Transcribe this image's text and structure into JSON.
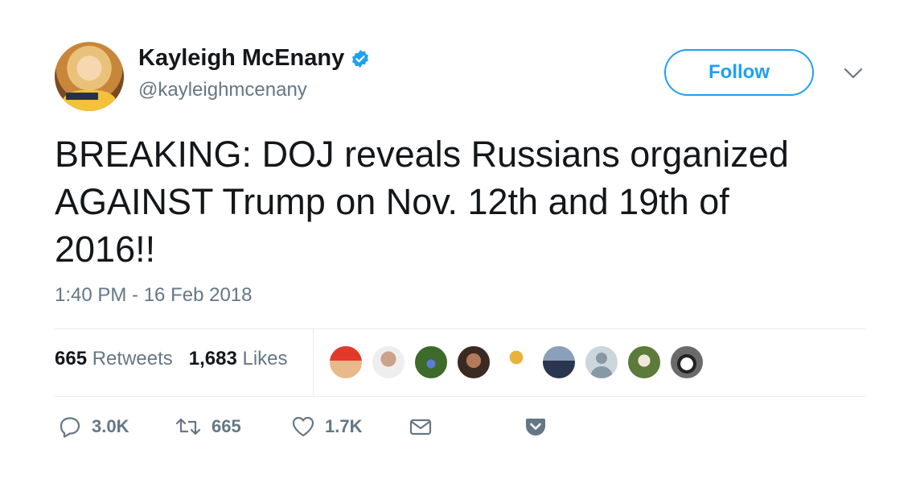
{
  "tweet": {
    "display_name": "Kayleigh McEnany",
    "handle": "@kayleighmcenany",
    "follow_label": "Follow",
    "text_lines": [
      "BREAKING: DOJ reveals Russians organized",
      "AGAINST Trump on Nov. 12th and 19th of",
      "2016!!"
    ],
    "timestamp": "1:40 PM - 16 Feb 2018"
  },
  "stats": {
    "retweets_count": "665",
    "retweets_label": "Retweets",
    "likes_count": "1,683",
    "likes_label": "Likes"
  },
  "actions": {
    "reply_count": "3.0K",
    "retweet_count": "665",
    "like_count": "1.7K"
  },
  "icons": {
    "verified": "verified-badge-icon",
    "caret": "chevron-down-icon",
    "reply": "reply-icon",
    "retweet": "retweet-icon",
    "like": "heart-icon",
    "message": "envelope-icon",
    "save": "pocket-icon"
  },
  "colors": {
    "accent": "#1da1f2",
    "text": "#14171a",
    "secondary": "#657786",
    "divider": "#e6ecf0"
  }
}
